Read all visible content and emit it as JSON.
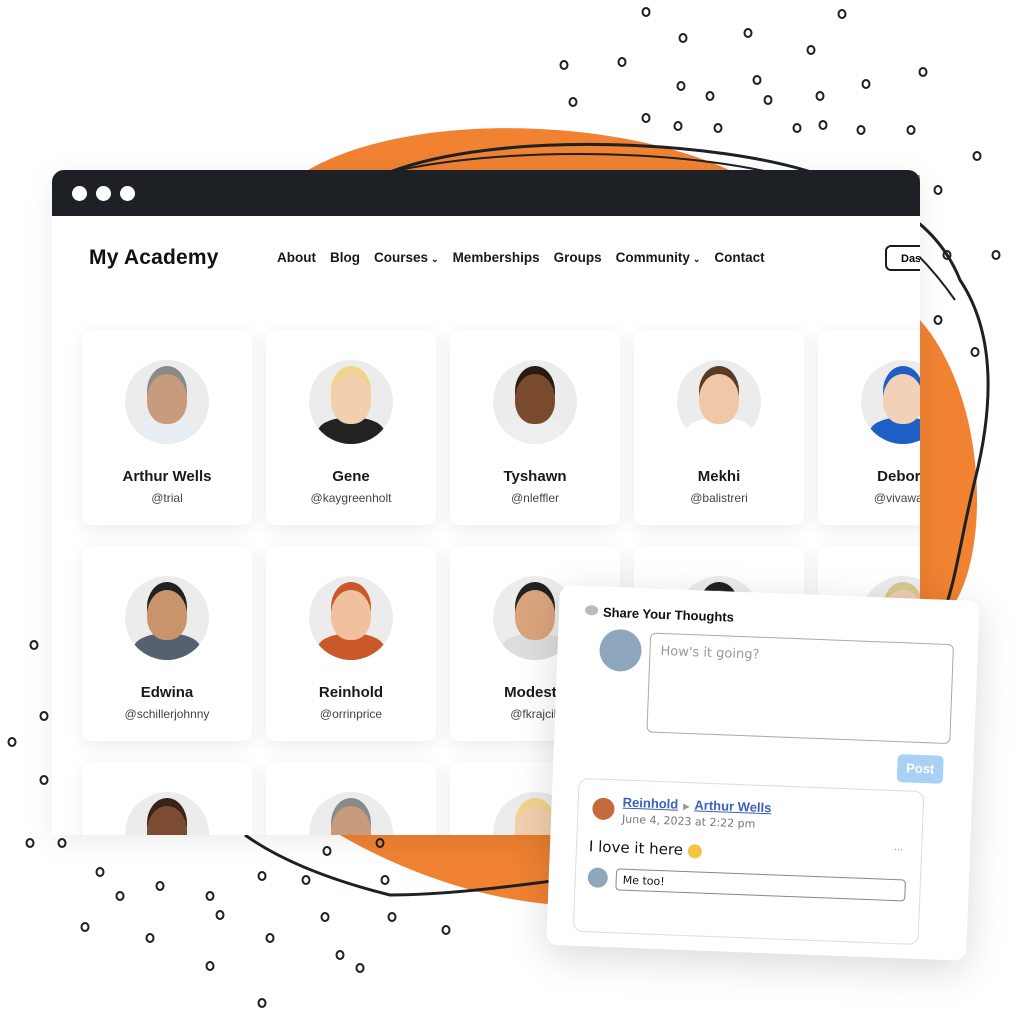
{
  "browser": {
    "controls": [
      "close",
      "minimize",
      "maximize"
    ]
  },
  "header": {
    "brand": "My Academy",
    "menu": [
      {
        "label": "About",
        "dropdown": false
      },
      {
        "label": "Blog",
        "dropdown": false
      },
      {
        "label": "Courses",
        "dropdown": true
      },
      {
        "label": "Memberships",
        "dropdown": false
      },
      {
        "label": "Groups",
        "dropdown": false
      },
      {
        "label": "Community",
        "dropdown": true
      },
      {
        "label": "Contact",
        "dropdown": false
      }
    ],
    "dashboard_button": "Das"
  },
  "members": [
    {
      "name": "Arthur Wells",
      "handle": "@trial"
    },
    {
      "name": "Gene",
      "handle": "@kaygreenholt"
    },
    {
      "name": "Tyshawn",
      "handle": "@nleffler"
    },
    {
      "name": "Mekhi",
      "handle": "@balistreri"
    },
    {
      "name": "Debora",
      "handle": "@vivawats"
    },
    {
      "name": "Edwina",
      "handle": "@schillerjohnny"
    },
    {
      "name": "Reinhold",
      "handle": "@orrinprice"
    },
    {
      "name": "Modesto",
      "handle": "@fkrajcik"
    },
    {
      "name": "",
      "handle": ""
    },
    {
      "name": "",
      "handle": ""
    },
    {
      "name": "",
      "handle": ""
    },
    {
      "name": "",
      "handle": ""
    },
    {
      "name": "",
      "handle": ""
    }
  ],
  "share": {
    "title": "Share Your Thoughts",
    "placeholder": "How's it going?",
    "post_label": "Post",
    "post_color": "#a9d0f5"
  },
  "comment": {
    "author": "Reinhold",
    "recipient": "Arthur Wells",
    "date": "June 4, 2023 at 2:22 pm",
    "text": "I love it here",
    "more": "...",
    "reply_value": "Me too!"
  },
  "colors": {
    "accent": "#f08232",
    "titlebar": "#1d2024",
    "link": "#3a62b8"
  }
}
